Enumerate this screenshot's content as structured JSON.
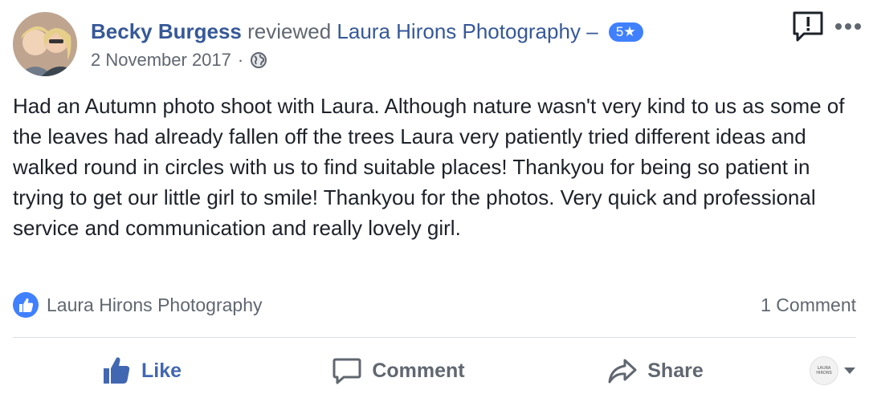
{
  "review": {
    "author": "Becky Burgess",
    "verb": "reviewed",
    "page_name": "Laura Hirons Photography",
    "dash": "–",
    "rating": "5★",
    "date": "2 November 2017",
    "separator": "·",
    "privacy_icon": "globe-icon",
    "body": "Had an Autumn photo shoot with Laura. Although nature wasn't very kind to us as some of the leaves had already fallen off the trees Laura very patiently tried different ideas and walked round in circles with us to find suitable places! Thankyou for being so patient in trying to get our little girl to smile! Thankyou for the photos. Very quick and professional service and communication and really lovely girl."
  },
  "stats": {
    "reactor": "Laura Hirons Photography",
    "comment_count": "1 Comment"
  },
  "actions": {
    "like": "Like",
    "comment": "Comment",
    "share": "Share"
  },
  "page_switcher": {
    "avatar_text": "LAURA HIRONS"
  },
  "colors": {
    "link": "#365899",
    "accent": "#4267b2",
    "badge": "#4080ff",
    "muted": "#606770"
  }
}
